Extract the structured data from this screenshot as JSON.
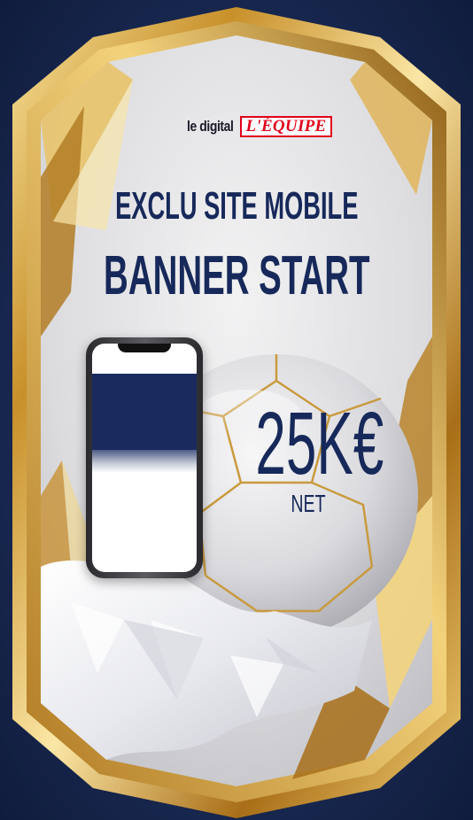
{
  "logo": {
    "prefix": "le digital",
    "brand": "L'ÉQUIPE",
    "brand_color": "#e2001a"
  },
  "headline_1": "EXCLU SITE MOBILE",
  "headline_2": "BANNER START",
  "price": {
    "amount": "25K€",
    "unit": "NET"
  },
  "colors": {
    "navy_text": "#17295a",
    "background": "#1e2f5c",
    "gold": "#d4a43a",
    "card_surface": "#e6e6e8"
  },
  "illustration": {
    "frame_icon": "gold-card-frame-icon",
    "ball_icon": "football-icon",
    "phone_icon": "smartphone-icon"
  }
}
